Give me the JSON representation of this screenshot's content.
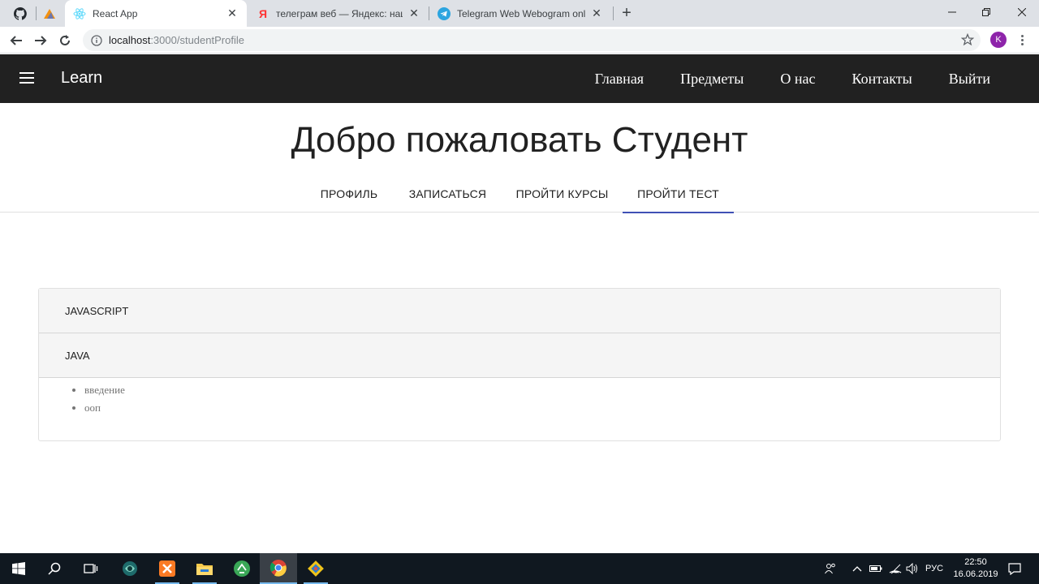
{
  "browser": {
    "tabs": [
      {
        "title": "React App",
        "active": true
      },
      {
        "title": "телеграм веб — Яндекс: нашлось",
        "active": false
      },
      {
        "title": "Telegram Web Webogram online",
        "active": false
      }
    ],
    "address": {
      "host": "localhost",
      "path": ":3000/studentProfile"
    },
    "profile_initial": "K"
  },
  "appbar": {
    "brand": "Learn",
    "links": [
      "Главная",
      "Предметы",
      "О нас",
      "Контакты",
      "Выйти"
    ]
  },
  "page": {
    "title": "Добро пожаловать Студент",
    "tabs": [
      "ПРОФИЛЬ",
      "ЗАПИСАТЬСЯ",
      "ПРОЙТИ КУРСЫ",
      "ПРОЙТИ ТЕСТ"
    ],
    "active_tab": "ПРОЙТИ ТЕСТ",
    "accordion": [
      {
        "title": "JAVASCRIPT",
        "expanded": false,
        "items": []
      },
      {
        "title": "JAVA",
        "expanded": true,
        "items": [
          "введение",
          "ооп"
        ]
      }
    ]
  },
  "taskbar": {
    "language": "РУС",
    "time": "22:50",
    "date": "16.06.2019"
  },
  "colors": {
    "appbar": "#212121",
    "active_tab_indicator": "#3f51b5",
    "taskbar": "#101820"
  }
}
